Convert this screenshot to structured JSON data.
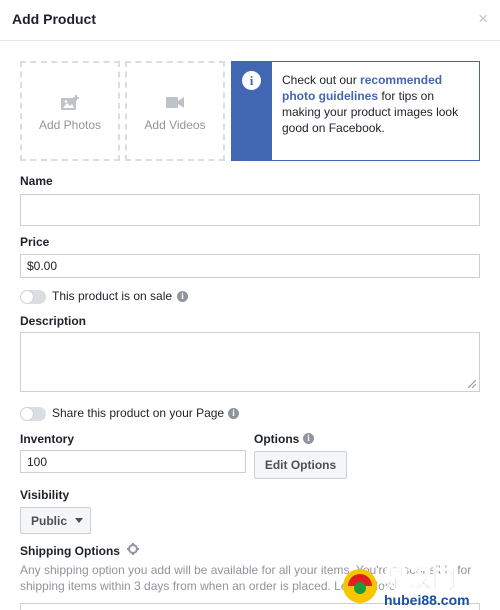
{
  "dialog": {
    "title": "Add Product",
    "close_glyph": "×"
  },
  "media": {
    "add_photos_label": "Add Photos",
    "add_videos_label": "Add Videos"
  },
  "tip": {
    "icon_glyph": "i",
    "prefix": "Check out our ",
    "link": "recommended photo guidelines",
    "suffix": " for tips on making your product images look good on Facebook."
  },
  "form": {
    "name_label": "Name",
    "name_value": "",
    "price_label": "Price",
    "price_value": "$0.00",
    "sale_toggle_label": "This product is on sale",
    "description_label": "Description",
    "description_value": "",
    "share_toggle_label": "Share this product on your Page",
    "inventory_label": "Inventory",
    "inventory_value": "100",
    "options_label": "Options",
    "edit_options_label": "Edit Options",
    "visibility_label": "Visibility",
    "visibility_value": "Public",
    "shipping_label": "Shipping Options",
    "shipping_desc": "Any shipping option you add will be available for all your items. You're responsible for shipping items within 3 days from when an order is placed. Learn More"
  },
  "watermark": {
    "text": "楚汉网",
    "sub": "hubei88.com"
  },
  "colors": {
    "accent": "#4267b2",
    "muted": "#90949c",
    "border": "#ccd0d5"
  }
}
